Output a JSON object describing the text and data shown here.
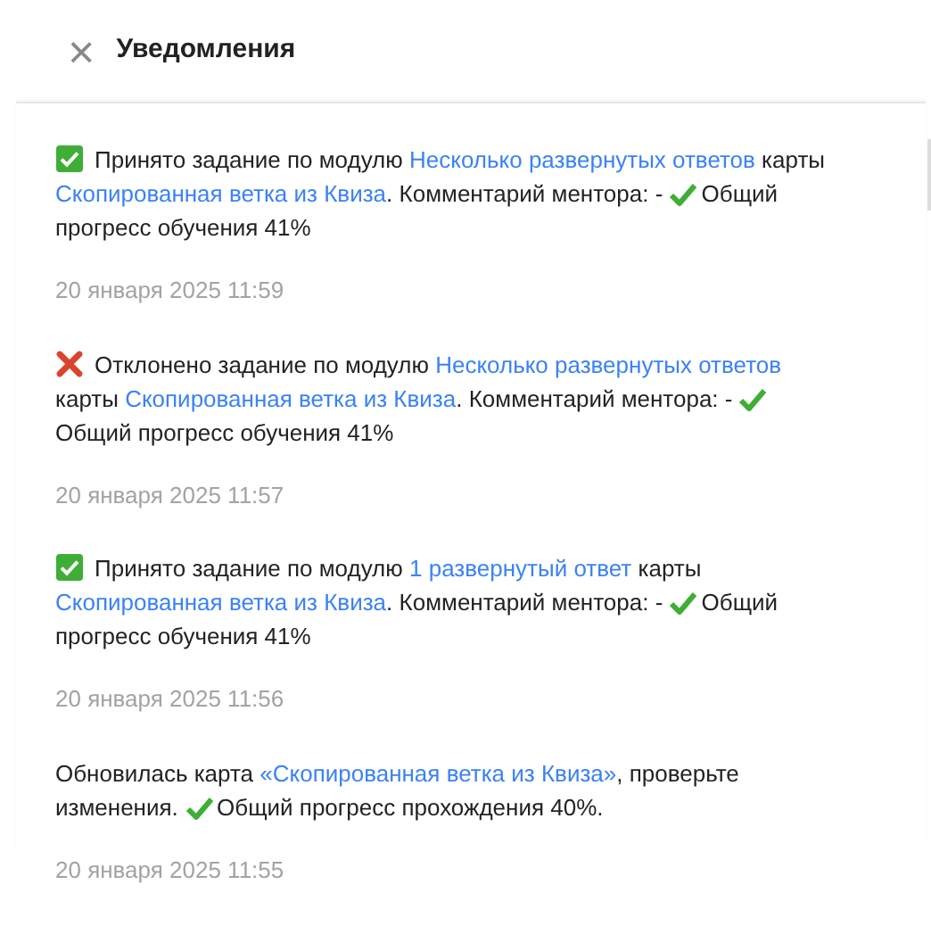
{
  "header": {
    "close": "×",
    "title": "Уведомления"
  },
  "notifications": [
    {
      "kind": "accepted",
      "segments": [
        {
          "kind": "text",
          "text": "Принято задание по модулю "
        },
        {
          "kind": "link",
          "text": "Несколько развернутых ответов"
        },
        {
          "kind": "text",
          "text": " карты "
        },
        {
          "kind": "link",
          "text": "Скопированная ветка из Квиза"
        },
        {
          "kind": "text",
          "text": ". Комментарий ментора: - "
        },
        {
          "kind": "check"
        },
        {
          "kind": "text",
          "text": "Общий прогресс обучения 41%"
        }
      ],
      "time": "20 января 2025 11:59"
    },
    {
      "kind": "rejected",
      "segments": [
        {
          "kind": "text",
          "text": "Отклонено задание по модулю "
        },
        {
          "kind": "link",
          "text": "Несколько развернутых ответов"
        },
        {
          "kind": "text",
          "text": " карты "
        },
        {
          "kind": "link",
          "text": "Скопированная ветка из Квиза"
        },
        {
          "kind": "text",
          "text": ". Комментарий ментора: - "
        },
        {
          "kind": "check"
        },
        {
          "kind": "text",
          "text": "Общий прогресс обучения 41%"
        }
      ],
      "time": "20 января 2025 11:57"
    },
    {
      "kind": "accepted",
      "segments": [
        {
          "kind": "text",
          "text": "Принято задание по модулю "
        },
        {
          "kind": "link",
          "text": "1 развернутый ответ"
        },
        {
          "kind": "text",
          "text": " карты "
        },
        {
          "kind": "link",
          "text": "Скопированная ветка из Квиза"
        },
        {
          "kind": "text",
          "text": ". Комментарий ментора: - "
        },
        {
          "kind": "check"
        },
        {
          "kind": "text",
          "text": "Общий прогресс обучения 41%"
        }
      ],
      "time": "20 января 2025 11:56"
    },
    {
      "kind": "update",
      "segments": [
        {
          "kind": "text",
          "text": "Обновилась карта "
        },
        {
          "kind": "link",
          "text": "«Скопированная ветка из Квиза»"
        },
        {
          "kind": "text",
          "text": ", проверьте изменения. "
        },
        {
          "kind": "check"
        },
        {
          "kind": "text",
          "text": "Общий прогресс прохождения 40%."
        }
      ],
      "time": "20 января 2025 11:55"
    }
  ]
}
